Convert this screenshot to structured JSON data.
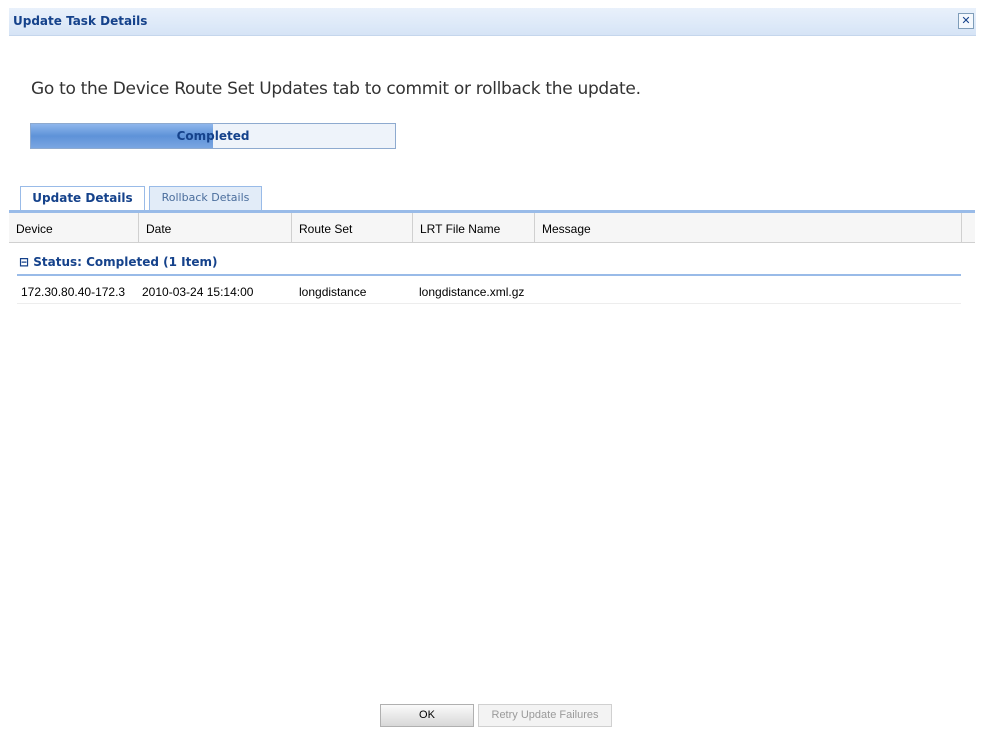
{
  "window": {
    "title": "Update Task Details",
    "close_glyph": "✕"
  },
  "message": "Go to the Device Route Set Updates tab to commit or rollback the update.",
  "progress": {
    "label": "Completed",
    "fraction": 0.5
  },
  "tabs": [
    {
      "label": "Update Details",
      "active": true
    },
    {
      "label": "Rollback Details",
      "active": false
    }
  ],
  "grid": {
    "columns": [
      "Device",
      "Date",
      "Route Set",
      "LRT File Name",
      "Message"
    ],
    "group": {
      "toggle_glyph": "⊟",
      "label": "Status: Completed (1 Item)"
    },
    "rows": [
      {
        "device": "172.30.80.40-172.3",
        "date": "2010-03-24 15:14:00",
        "route_set": "longdistance",
        "lrt_file": "longdistance.xml.gz",
        "message": ""
      }
    ]
  },
  "buttons": {
    "ok": "OK",
    "retry": "Retry Update Failures"
  },
  "colors": {
    "accent": "#15428b",
    "tab_border": "#99bbe8"
  }
}
